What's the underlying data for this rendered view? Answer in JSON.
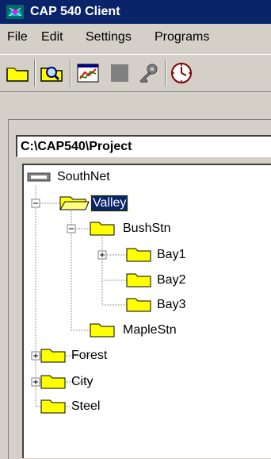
{
  "window": {
    "title": "CAP 540  Client"
  },
  "menu": [
    "File",
    "Edit",
    "Settings",
    "Programs"
  ],
  "toolbar": {
    "buttons": [
      {
        "name": "open-folder-icon"
      },
      {
        "name": "find-icon"
      },
      {
        "name": "chart-icon"
      },
      {
        "name": "stop-icon"
      },
      {
        "name": "key-icon"
      },
      {
        "name": "clock-icon"
      }
    ]
  },
  "path": "C:\\CAP540\\Project",
  "tree": {
    "root": "SouthNet",
    "nodes": [
      {
        "label": "Valley",
        "selected": true,
        "expander": "minus"
      },
      {
        "label": "BushStn",
        "expander": "minus"
      },
      {
        "label": "Bay1",
        "expander": "plus"
      },
      {
        "label": "Bay2"
      },
      {
        "label": "Bay3"
      },
      {
        "label": "MapleStn"
      },
      {
        "label": "Forest",
        "expander": "plus"
      },
      {
        "label": "City",
        "expander": "plus"
      },
      {
        "label": "Steel"
      }
    ]
  },
  "colors": {
    "titlebar": "#0a246a",
    "selection": "#0a246a",
    "folder": "#ffff00",
    "chrome": "#d4d0c8"
  }
}
